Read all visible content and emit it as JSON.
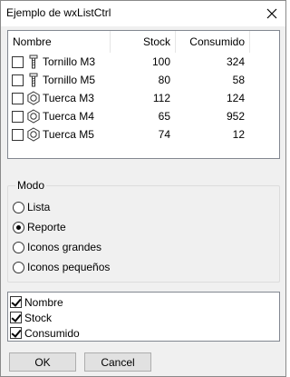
{
  "window": {
    "title": "Ejemplo de wxListCtrl"
  },
  "list": {
    "columns": [
      "Nombre",
      "Stock",
      "Consumido"
    ],
    "rows": [
      {
        "icon": "screw-icon",
        "name": "Tornillo M3",
        "stock": "100",
        "consumed": "324"
      },
      {
        "icon": "screw-icon",
        "name": "Tornillo M5",
        "stock": "80",
        "consumed": "58"
      },
      {
        "icon": "nut-icon",
        "name": "Tuerca M3",
        "stock": "112",
        "consumed": "124"
      },
      {
        "icon": "nut-icon",
        "name": "Tuerca M4",
        "stock": "65",
        "consumed": "952"
      },
      {
        "icon": "nut-icon",
        "name": "Tuerca M5",
        "stock": "74",
        "consumed": "12"
      }
    ]
  },
  "mode": {
    "label": "Modo",
    "options": [
      "Lista",
      "Reporte",
      "Iconos grandes",
      "Iconos pequeños"
    ],
    "selected": "Reporte"
  },
  "columns_visibility": {
    "items": [
      {
        "label": "Nombre",
        "checked": true
      },
      {
        "label": "Stock",
        "checked": true
      },
      {
        "label": "Consumido",
        "checked": true
      }
    ]
  },
  "buttons": {
    "ok": "OK",
    "cancel": "Cancel"
  }
}
